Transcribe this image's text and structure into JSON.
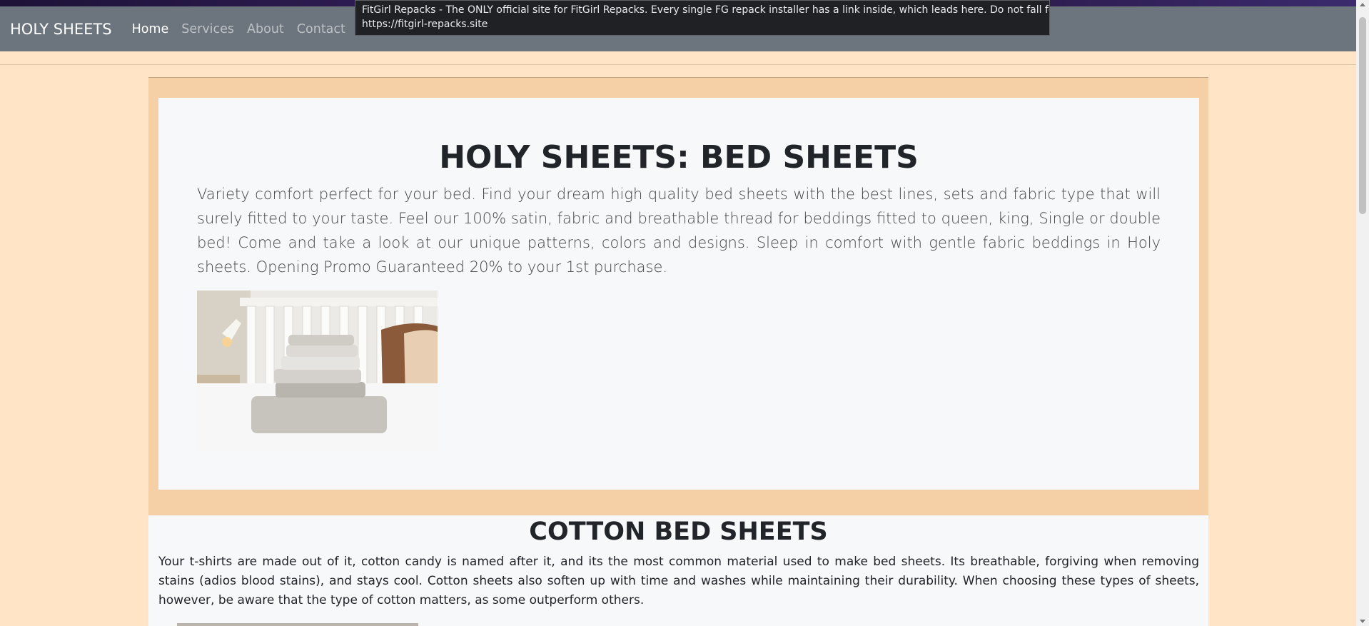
{
  "navbar": {
    "brand": "HOLY SHEETS",
    "links": [
      {
        "label": "Home",
        "active": true
      },
      {
        "label": "Services",
        "active": false
      },
      {
        "label": "About",
        "active": false
      },
      {
        "label": "Contact",
        "active": false
      }
    ]
  },
  "tooltip": {
    "title": "FitGirl Repacks - The ONLY official site for FitGirl Repacks. Every single FG repack installer has a link inside, which leads here. Do not fall for fake...",
    "url": "https://fitgirl-repacks.site"
  },
  "hero": {
    "heading": "HOLY SHEETS: BED SHEETS",
    "text": "Variety comfort perfect for your bed. Find your dream high quality bed sheets with the best lines, sets and fabric type that will surely fitted to your taste. Feel our 100% satin, fabric and breathable thread for beddings fitted to queen, king, Single or double bed! Come and take a look at our unique patterns, colors and designs. Sleep in comfort with gentle fabric beddings in Holy sheets. Opening Promo Guaranteed 20% to your 1st purchase."
  },
  "cotton": {
    "heading": "COTTON BED SHEETS",
    "text": "Your t-shirts are made out of it, cotton candy is named after it, and its the most common material used to make bed sheets. Its breathable, forgiving when removing stains (adios blood stains), and stays cool. Cotton sheets also soften up with time and washes while maintaining their durability. When choosing these types of sheets, however, be aware that the type of cotton matters, as some outperform others."
  },
  "colors": {
    "page_background": "#ffe4c6",
    "navbar": "#6c757d",
    "jumbotron_frame": "#f5d0a6",
    "card": "#f7f8fa"
  }
}
